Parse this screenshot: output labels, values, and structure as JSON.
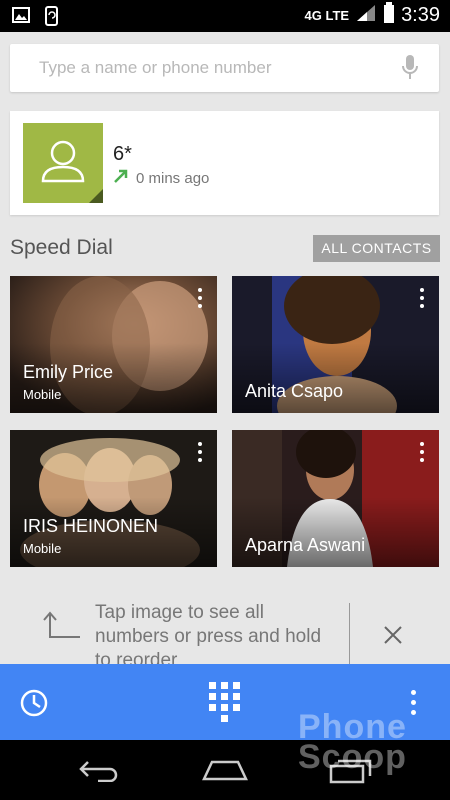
{
  "status_bar": {
    "network": "4G LTE",
    "time": "3:39"
  },
  "search": {
    "placeholder": "Type a name or phone number"
  },
  "recent_call": {
    "number": "6*",
    "time": "0 mins ago"
  },
  "speed_dial": {
    "title": "Speed Dial",
    "all_contacts_label": "ALL CONTACTS",
    "contacts": [
      {
        "name": "Emily Price",
        "type": "Mobile"
      },
      {
        "name": "Anita Csapo",
        "type": ""
      },
      {
        "name": "IRIS HEINONEN",
        "type": "Mobile"
      },
      {
        "name": "Aparna Aswani",
        "type": ""
      }
    ]
  },
  "hint": {
    "text": "Tap image to see all numbers or press and hold to reorder"
  },
  "colors": {
    "action_bar": "#4285f4",
    "avatar_bg": "#a0b845",
    "outgoing_arrow": "#4caf50"
  },
  "icons": [
    "image-icon",
    "phone-sync-icon",
    "signal-icon",
    "battery-icon",
    "mic-icon",
    "person-icon",
    "outgoing-call-icon",
    "overflow-menu-icon",
    "reorder-arrow-icon",
    "close-icon",
    "recent-clock-icon",
    "dialpad-icon",
    "back-icon",
    "home-icon",
    "recent-apps-icon"
  ],
  "watermark": "Phone Scoop"
}
